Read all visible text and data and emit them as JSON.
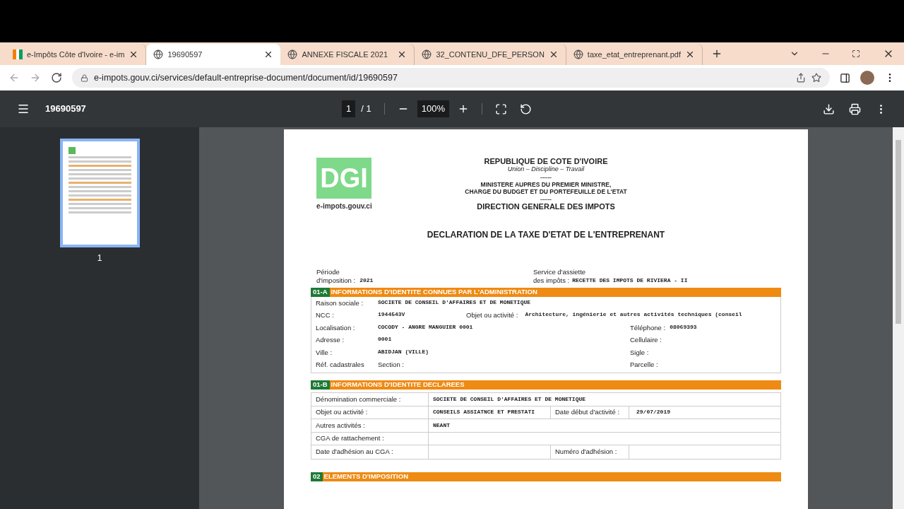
{
  "browser": {
    "tabs": [
      {
        "title": "e-Impôts Côte d'Ivoire - e-im",
        "kind": "flag",
        "selected": false
      },
      {
        "title": "19690597",
        "kind": "web",
        "selected": true
      },
      {
        "title": "ANNEXE FISCALE 2021",
        "kind": "web",
        "selected": false
      },
      {
        "title": "32_CONTENU_DFE_PERSON",
        "kind": "web",
        "selected": false
      },
      {
        "title": "taxe_etat_entreprenant.pdf",
        "kind": "web",
        "selected": false
      }
    ],
    "url": "e-impots.gouv.ci/services/default-entreprise-document/document/id/19690597"
  },
  "viewer": {
    "title": "19690597",
    "page": "1",
    "pages": "/ 1",
    "zoom": "100%",
    "thumbnails": [
      {
        "label": "1",
        "selected": true
      }
    ]
  },
  "document": {
    "logo": {
      "letters": "DGI",
      "site": "e-impots.gouv.ci"
    },
    "header": {
      "country": "REPUBLIQUE DE COTE D'IVOIRE",
      "motto": "Union – Discipline – Travail",
      "sep1": "------",
      "ministry": [
        "MINISTERE AUPRES DU PREMIER MINISTRE,",
        "CHARGE DU BUDGET ET DU PORTEFEUILLE DE L'ETAT"
      ],
      "sep2": "------",
      "direction": "DIRECTION GENERALE DES IMPOTS"
    },
    "title": "DECLARATION DE LA TAXE D'ETAT DE L'ENTREPRENANT",
    "period": {
      "label_1": "Période",
      "label_2": "d'imposition :",
      "value": "2021"
    },
    "service": {
      "label_1": "Service d'assiette",
      "label_2": "des impôts :",
      "value": "RECETTE DES IMPOTS DE RIVIERA - II"
    },
    "section_a": {
      "code": "01-A",
      "title": "INFORMATIONS D'IDENTITE CONNUES PAR L'ADMINISTRATION",
      "rows": [
        {
          "label": "Raison sociale :",
          "value": "SOCIETE DE CONSEIL D'AFFAIRES ET DE MONETIQUE"
        },
        {
          "label": "NCC :",
          "value": "1944543V",
          "mid_label": "Objet ou activité :",
          "mid_value": "Architecture, ingénierie et autres activités techniques (conseil"
        },
        {
          "label": "Localisation :",
          "value": "COCODY - ANGRE MANGUIER 0001",
          "right_label": "Téléphone :",
          "right_value": "08069393"
        },
        {
          "label": "Adresse :",
          "value": "0001",
          "right_label": "Cellulaire :"
        },
        {
          "label": "Ville :",
          "value": "ABIDJAN (VILLE)",
          "right_label": "Sigle :"
        },
        {
          "label": "Réf. cadastrales",
          "sub_label": "Section :",
          "right_label": "Parcelle :"
        }
      ]
    },
    "section_b": {
      "code": "01-B",
      "title": "INFORMATIONS D'IDENTITE DECLAREES",
      "rows": [
        {
          "label": "Dénomination commerciale :",
          "value": "SOCIETE DE CONSEIL D'AFFAIRES ET DE MONETIQUE"
        },
        {
          "label": "Objet ou activité :",
          "value": "CONSEILS ASSIATNCE ET PRESTATI",
          "label_2": "Date début d'activité :",
          "value_2": "29/07/2019"
        },
        {
          "label": "Autres activités :",
          "value": "NEANT"
        },
        {
          "label": "CGA de rattachement  :"
        },
        {
          "label": "Date d'adhésion au CGA :",
          "label_2": "Numéro d'adhésion :"
        }
      ]
    },
    "section_c": {
      "code": "02",
      "title": "ELEMENTS D'IMPOSITION"
    }
  }
}
